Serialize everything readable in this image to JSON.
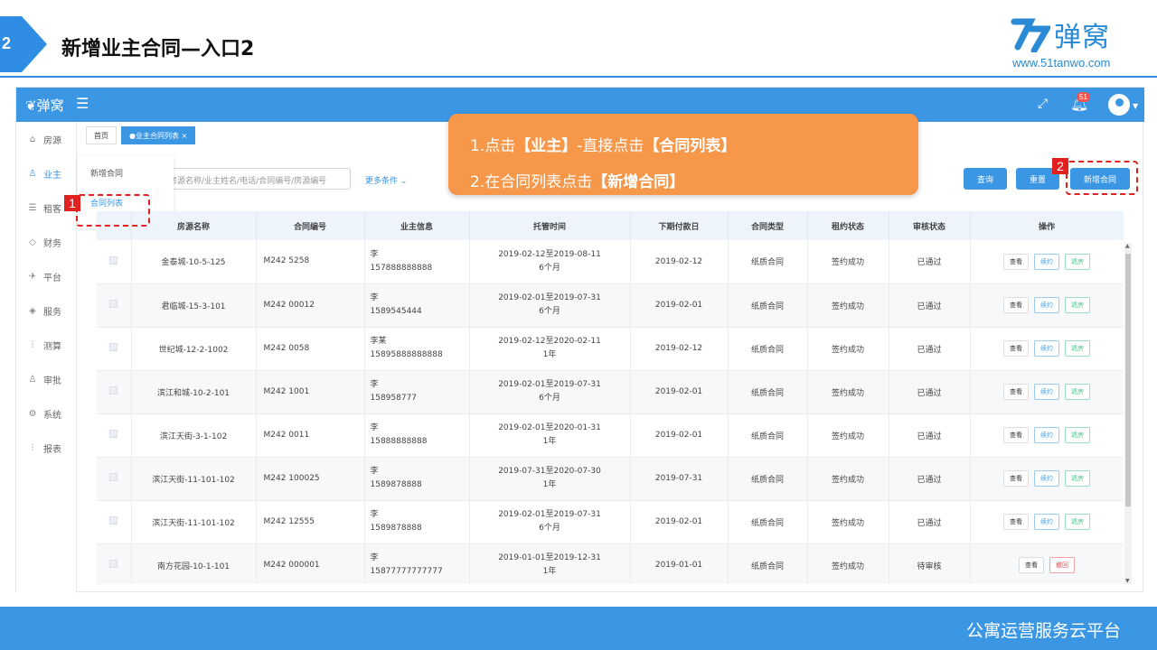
{
  "slide": {
    "number": "2",
    "title": "新增业主合同—入口2"
  },
  "brand": {
    "name": "弹窝",
    "url": "www.51tanwo.com"
  },
  "app": {
    "logo": "弹窝",
    "notification_count": "51"
  },
  "sidebar": {
    "items": [
      {
        "label": "房源",
        "icon": "home-icon"
      },
      {
        "label": "业主",
        "icon": "user-icon"
      },
      {
        "label": "租客",
        "icon": "database-icon"
      },
      {
        "label": "财务",
        "icon": "diamond-icon"
      },
      {
        "label": "平台",
        "icon": "plane-icon"
      },
      {
        "label": "服务",
        "icon": "tag-icon"
      },
      {
        "label": "测算",
        "icon": "sliders-icon"
      },
      {
        "label": "审批",
        "icon": "person-icon"
      },
      {
        "label": "系统",
        "icon": "gear-icon"
      },
      {
        "label": "报表",
        "icon": "sliders-icon"
      }
    ]
  },
  "tabs": {
    "home": "首页",
    "current": "●业主合同列表",
    "close": "×"
  },
  "submenu": {
    "new_contract": "新增合同",
    "contract_list": "合同列表"
  },
  "search": {
    "placeholder": "房源名称/业主姓名/电话/合同编号/房源编号",
    "more": "更多条件"
  },
  "toolbar": {
    "query": "查询",
    "reset": "重置",
    "new": "新增合同"
  },
  "callout": {
    "line1_prefix": "1.点击",
    "line1_b1": "【业主】",
    "line1_mid": "-直接点击",
    "line1_b2": "【合同列表】",
    "line2_prefix": "2.在合同列表点击",
    "line2_b": "【新增合同】"
  },
  "markers": {
    "one": "1",
    "two": "2"
  },
  "table": {
    "columns": [
      "房源名称",
      "合同编号",
      "业主信息",
      "托管时间",
      "下期付款日",
      "合同类型",
      "租约状态",
      "审核状态",
      "操作"
    ],
    "actions": {
      "view": "查看",
      "renew": "续约",
      "refund": "退房",
      "withdraw": "撤回"
    },
    "rows": [
      {
        "name": "金泰城-10-5-125",
        "code": "M242 5258",
        "owner": "李",
        "phone": "157888888888",
        "period": "2019-02-12至2019-08-11",
        "duration": "6个月",
        "next_pay": "2019-02-12",
        "type": "纸质合同",
        "lease": "签约成功",
        "audit": "已通过"
      },
      {
        "name": "君临城-15-3-101",
        "code": "M242 00012",
        "owner": "李",
        "phone": "1589545444",
        "period": "2019-02-01至2019-07-31",
        "duration": "6个月",
        "next_pay": "2019-02-01",
        "type": "纸质合同",
        "lease": "签约成功",
        "audit": "已通过"
      },
      {
        "name": "世纪城-12-2-1002",
        "code": "M242 0058",
        "owner": "李某",
        "phone": "15895888888888",
        "period": "2019-02-12至2020-02-11",
        "duration": "1年",
        "next_pay": "2019-02-12",
        "type": "纸质合同",
        "lease": "签约成功",
        "audit": "已通过"
      },
      {
        "name": "滨江和城-10-2-101",
        "code": "M242 1001",
        "owner": "李",
        "phone": "158958777",
        "period": "2019-02-01至2019-07-31",
        "duration": "6个月",
        "next_pay": "2019-02-01",
        "type": "纸质合同",
        "lease": "签约成功",
        "audit": "已通过"
      },
      {
        "name": "滨江天街-3-1-102",
        "code": "M242 0011",
        "owner": "李",
        "phone": "15888888888",
        "period": "2019-02-01至2020-01-31",
        "duration": "1年",
        "next_pay": "2019-02-01",
        "type": "纸质合同",
        "lease": "签约成功",
        "audit": "已通过"
      },
      {
        "name": "滨江天街-11-101-102",
        "code": "M242 100025",
        "owner": "李",
        "phone": "1589878888",
        "period": "2019-07-31至2020-07-30",
        "duration": "1年",
        "next_pay": "2019-07-31",
        "type": "纸质合同",
        "lease": "签约成功",
        "audit": "已通过"
      },
      {
        "name": "滨江天街-11-101-102",
        "code": "M242 12555",
        "owner": "李",
        "phone": "1589878888",
        "period": "2019-02-01至2019-07-31",
        "duration": "6个月",
        "next_pay": "2019-02-01",
        "type": "纸质合同",
        "lease": "签约成功",
        "audit": "已通过"
      },
      {
        "name": "南方花园-10-1-101",
        "code": "M242 000001",
        "owner": "李",
        "phone": "15877777777777",
        "period": "2019-01-01至2019-12-31",
        "duration": "1年",
        "next_pay": "2019-01-01",
        "type": "纸质合同",
        "lease": "签约成功",
        "audit": "待审核"
      }
    ]
  },
  "footer": {
    "text": "公寓运营服务云平台"
  },
  "colors": {
    "primary": "#3b96e4",
    "callout": "#f69749",
    "marker": "#e32020"
  }
}
